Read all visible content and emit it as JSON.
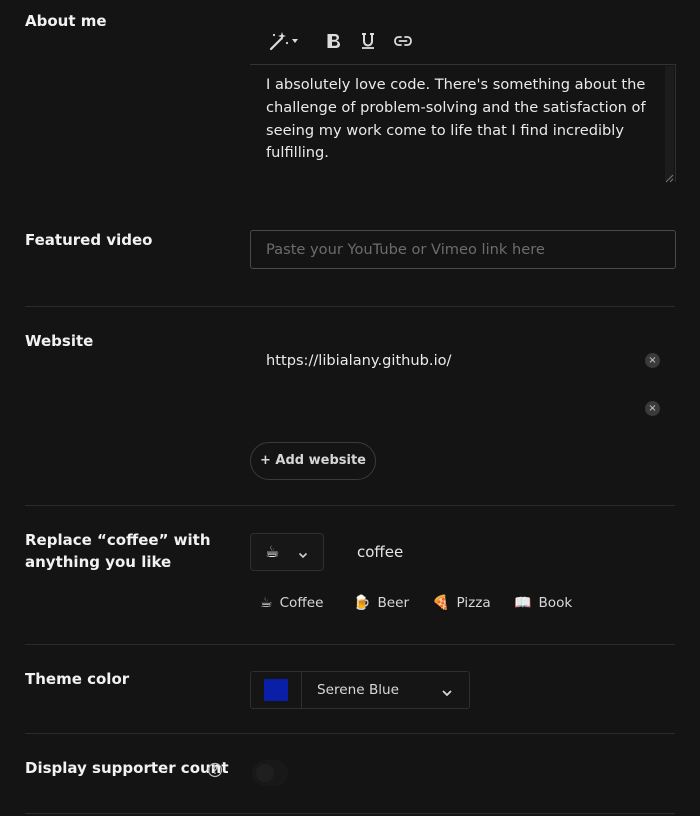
{
  "about": {
    "label": "About me",
    "text": "I absolutely love code. There's something about the challenge of problem-solving and the satisfaction of seeing my work come to life that I find incredibly fulfilling."
  },
  "toolbar": {
    "icons": [
      "magic-wand-icon",
      "bold-icon",
      "underline-icon",
      "link-icon"
    ]
  },
  "video": {
    "label": "Featured video",
    "placeholder": "Paste your YouTube or Vimeo link here",
    "value": ""
  },
  "website": {
    "label": "Website",
    "urls": [
      "https://libialany.github.io/",
      ""
    ],
    "clear_symbol": "×",
    "add_label": "+ Add website"
  },
  "coffee": {
    "label": "Replace “coffee” with anything you like",
    "selected_emoji": "☕",
    "word": "coffee",
    "options": [
      {
        "emoji": "☕",
        "name": "Coffee"
      },
      {
        "emoji": "🍺",
        "name": "Beer"
      },
      {
        "emoji": "🍕",
        "name": "Pizza"
      },
      {
        "emoji": "📖",
        "name": "Book"
      }
    ]
  },
  "theme": {
    "label": "Theme color",
    "selected": "Serene Blue",
    "swatch": "#0a1fa8"
  },
  "supporter": {
    "label": "Display supporter count",
    "help_icon": "help-circle-icon",
    "enabled": false
  },
  "colors": {
    "background": "#141414",
    "text": "#f2f2f2",
    "border": "#4a4a4a"
  }
}
